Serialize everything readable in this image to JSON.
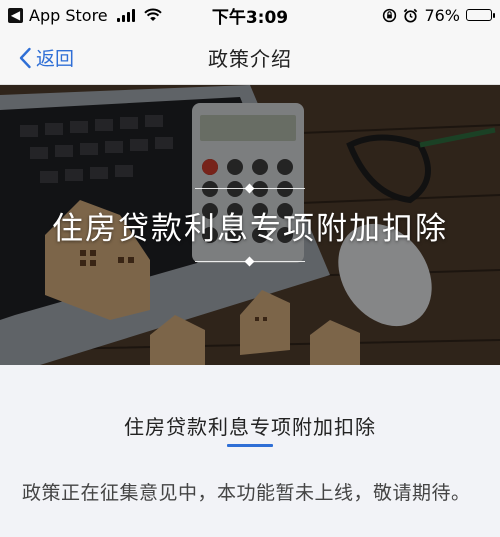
{
  "status_bar": {
    "back_app": "App Store",
    "time": "下午3:09",
    "battery": "76%",
    "battery_level": 0.76,
    "icons": [
      "back-app-icon",
      "signal-icon",
      "wifi-icon",
      "rotation-lock-icon",
      "alarm-icon",
      "battery-icon"
    ]
  },
  "nav": {
    "back_label": "返回",
    "title": "政策介绍",
    "accent_color": "#2f6fd6"
  },
  "hero": {
    "title": "住房贷款利息专项附加扣除"
  },
  "content": {
    "section_title": "住房贷款利息专项附加扣除",
    "body": "政策正在征集意见中，本功能暂未上线，敬请期待。"
  }
}
